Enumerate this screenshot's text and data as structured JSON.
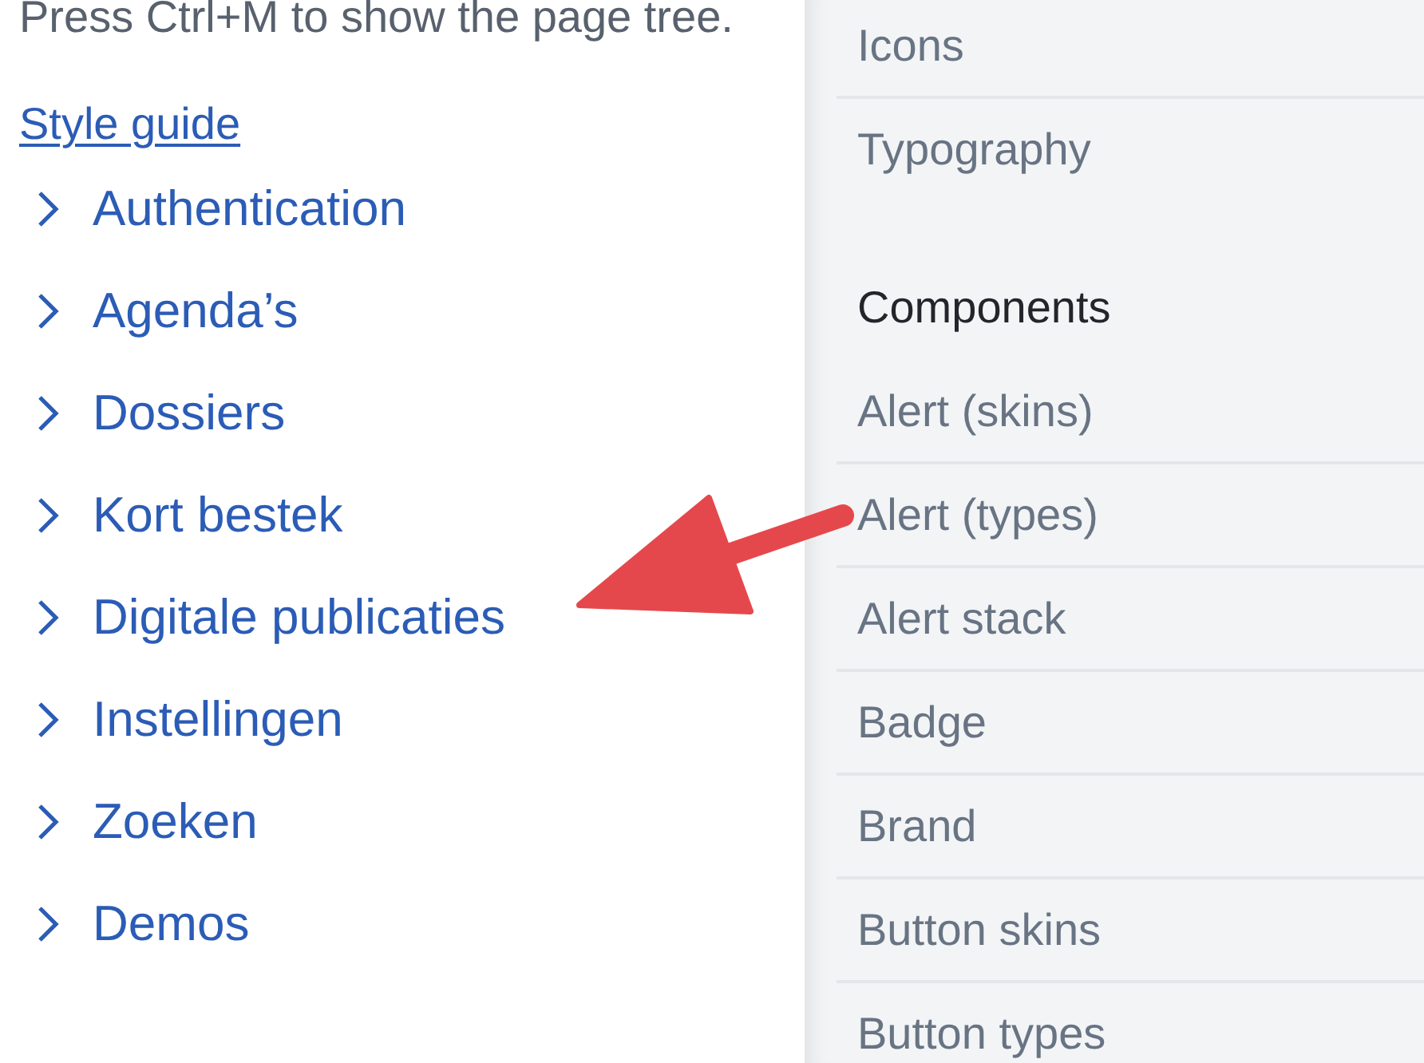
{
  "page_tree_hint": "Press Ctrl+M to show the page tree.",
  "root_link": "Style guide",
  "tree": [
    {
      "label": "Authentication",
      "expanded": false
    },
    {
      "label": "Agenda’s",
      "expanded": false
    },
    {
      "label": "Dossiers",
      "expanded": false
    },
    {
      "label": "Kort bestek",
      "expanded": false
    },
    {
      "label": "Digitale publicaties",
      "expanded": false
    },
    {
      "label": "Instellingen",
      "expanded": false
    },
    {
      "label": "Zoeken",
      "expanded": false
    },
    {
      "label": "Demos",
      "expanded": false
    }
  ],
  "sidebar": {
    "groups": [
      {
        "items": [
          "Icons",
          "Typography"
        ]
      },
      {
        "heading": "Components",
        "items": [
          "Alert (skins)",
          "Alert (types)",
          "Alert stack",
          "Badge",
          "Brand",
          "Button skins",
          "Button types"
        ]
      }
    ]
  }
}
